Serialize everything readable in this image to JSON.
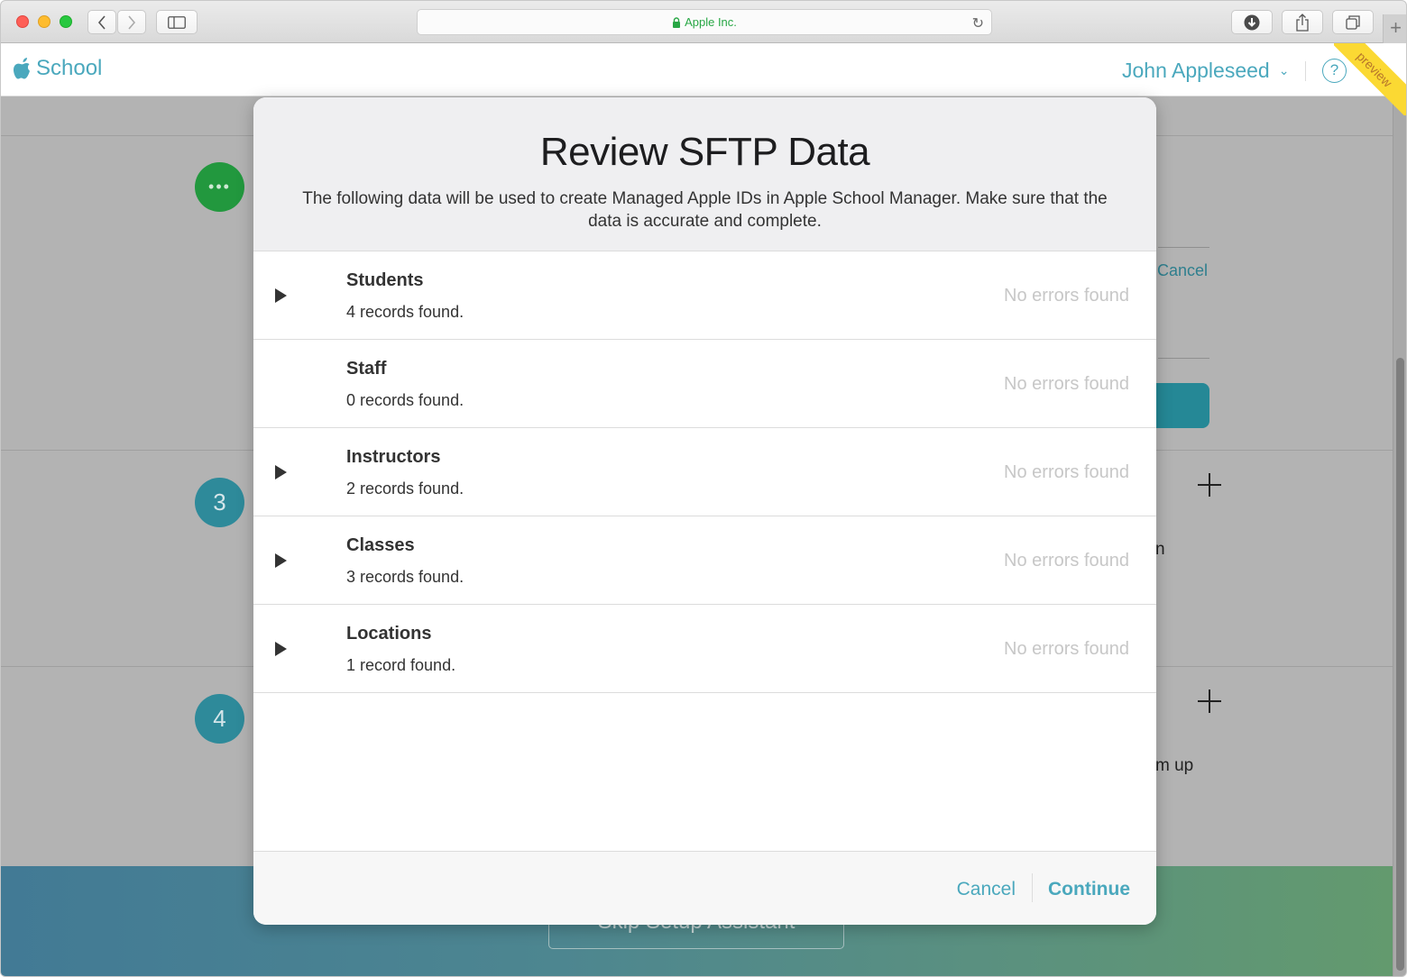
{
  "browser": {
    "address_host": "Apple Inc.",
    "nav_back": "back",
    "nav_forward": "forward"
  },
  "app": {
    "brand": "School",
    "user_name": "John Appleseed",
    "help_label": "?",
    "ribbon_label": "preview"
  },
  "background": {
    "steps": [
      "•••",
      "3",
      "4"
    ],
    "cancel_link": "Cancel",
    "fragment_n": "n",
    "fragment_m_up": "m up",
    "skip_button": "Skip Setup Assistant"
  },
  "modal": {
    "title": "Review SFTP Data",
    "subtitle": "The following data will be used to create Managed Apple IDs in Apple School Manager. Make sure that the data is accurate and complete.",
    "rows": [
      {
        "name": "Students",
        "count": "4 records found.",
        "status": "No errors found",
        "expandable": true
      },
      {
        "name": "Staff",
        "count": "0 records found.",
        "status": "No errors found",
        "expandable": false
      },
      {
        "name": "Instructors",
        "count": "2 records found.",
        "status": "No errors found",
        "expandable": true
      },
      {
        "name": "Classes",
        "count": "3 records found.",
        "status": "No errors found",
        "expandable": true
      },
      {
        "name": "Locations",
        "count": "1 record found.",
        "status": "No errors found",
        "expandable": true
      }
    ],
    "cancel_label": "Cancel",
    "continue_label": "Continue"
  },
  "colors": {
    "accent": "#4aa8bd",
    "secure_host": "#28a745",
    "step_done": "#22983e",
    "step_pending": "#2e8a9a",
    "ribbon": "#fbd933"
  }
}
